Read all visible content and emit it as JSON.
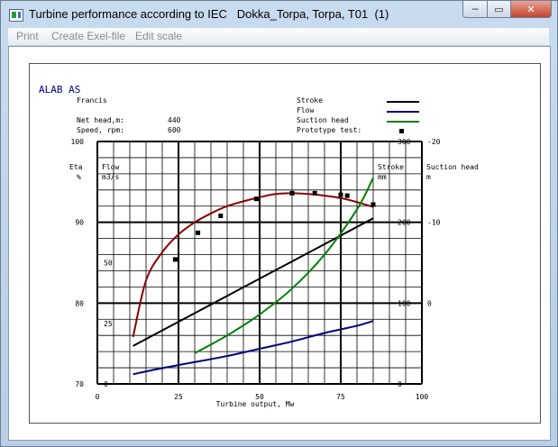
{
  "window": {
    "title": "Turbine performance according to IEC   Dokka_Torpa, Torpa, T01  (1)",
    "controls": {
      "minimize": "─",
      "maximize": "▭",
      "close": "✕"
    }
  },
  "menu": {
    "items": [
      "Print",
      "Create Exel-file",
      "Edit scale"
    ]
  },
  "header": {
    "company": "ALAB AS",
    "turbine_type": "Francis",
    "net_head_label": "Net head,m:",
    "net_head_value": "440",
    "speed_label": "Speed, rpm:",
    "speed_value": "600"
  },
  "chart_data": {
    "type": "line",
    "title": "ALAB AS",
    "xlabel": "Turbine output, Mw",
    "xlim": [
      0,
      100
    ],
    "x_ticks": [
      "0",
      "25",
      "50",
      "75",
      "100"
    ],
    "axes": {
      "eta": {
        "label": "Eta",
        "unit": "%",
        "range": [
          70,
          100
        ],
        "ticks": [
          "70",
          "80",
          "90",
          "100"
        ]
      },
      "flow": {
        "label": "Flow",
        "unit": "m3/s",
        "range": [
          0,
          100
        ],
        "ticks": [
          "0",
          "25",
          "50"
        ]
      },
      "stroke": {
        "label": "Stroke",
        "unit": "mm",
        "range": [
          0,
          300
        ],
        "ticks": [
          "0",
          "100",
          "200",
          "300"
        ]
      },
      "suction_head": {
        "label": "Suction head",
        "unit": "m",
        "range": [
          10,
          -20
        ],
        "ticks": [
          "0",
          "-10",
          "-20"
        ]
      }
    },
    "legend": [
      {
        "name": "Stroke",
        "color": "#000000",
        "type": "line"
      },
      {
        "name": "Flow",
        "color": "#000080",
        "type": "line"
      },
      {
        "name": "Suction head",
        "color": "#008000",
        "type": "line"
      },
      {
        "name": "Prototype test:",
        "color": "#000000",
        "type": "marker"
      }
    ],
    "series": [
      {
        "name": "Eta",
        "axis": "eta",
        "color": "#8b0000",
        "x": [
          11,
          15,
          20,
          25,
          30,
          35,
          40,
          45,
          50,
          55,
          60,
          65,
          70,
          75,
          80,
          85
        ],
        "y": [
          75.8,
          82.8,
          86.3,
          88.5,
          90.0,
          91.1,
          92.0,
          92.6,
          93.1,
          93.5,
          93.6,
          93.5,
          93.3,
          93.0,
          92.5,
          91.9
        ]
      },
      {
        "name": "Stroke",
        "axis": "stroke",
        "color": "#000000",
        "x": [
          11,
          85
        ],
        "y": [
          47,
          205
        ]
      },
      {
        "name": "Flow",
        "axis": "flow",
        "color": "#000080",
        "x": [
          11,
          20,
          30,
          40,
          50,
          60,
          70,
          80,
          85
        ],
        "y": [
          4,
          6.5,
          9,
          11.5,
          14.5,
          17.5,
          21,
          24,
          26
        ]
      },
      {
        "name": "Suction head",
        "axis": "suction_head",
        "color": "#008000",
        "x": [
          30,
          40,
          50,
          60,
          70,
          80,
          85
        ],
        "y": [
          6.2,
          4.0,
          1.4,
          -1.8,
          -6.0,
          -11.6,
          -15.5
        ]
      }
    ],
    "prototype_test": {
      "name": "Prototype test:",
      "axis": "eta",
      "x": [
        24,
        31,
        38,
        49,
        60,
        67,
        75,
        77,
        85
      ],
      "y": [
        85.4,
        88.7,
        90.8,
        92.9,
        93.6,
        93.6,
        93.4,
        93.3,
        92.2
      ]
    },
    "grid": true
  }
}
